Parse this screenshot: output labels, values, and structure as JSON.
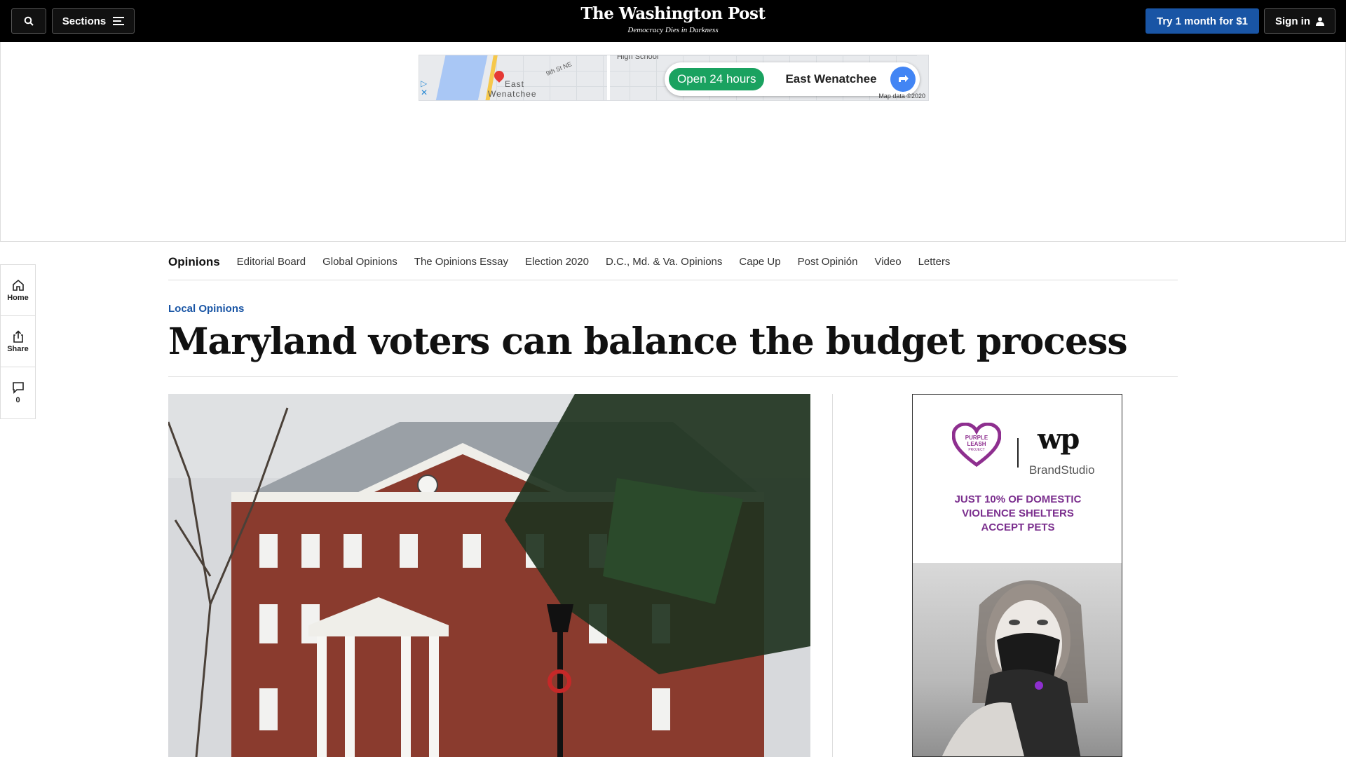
{
  "topbar": {
    "sections_label": "Sections",
    "masthead_title": "The Washington Post",
    "masthead_tagline": "Democracy Dies in Darkness",
    "subscribe_label": "Try 1 month for $1",
    "signin_label": "Sign in"
  },
  "map_ad": {
    "map_label_1": "East",
    "map_label_2": "Wenatchee",
    "street_label": "9th St NE",
    "school_label": "High School",
    "open_label": "Open 24 hours",
    "place_label": "East Wenatchee",
    "map_data_label": "Map data ©2020"
  },
  "rail": {
    "home_label": "Home",
    "share_label": "Share",
    "comments_count": "0"
  },
  "subnav": {
    "title": "Opinions",
    "items": [
      "Editorial Board",
      "Global Opinions",
      "The Opinions Essay",
      "Election 2020",
      "D.C., Md. & Va. Opinions",
      "Cape Up",
      "Post Opinión",
      "Video",
      "Letters"
    ]
  },
  "article": {
    "kicker": "Local Opinions",
    "headline": "Maryland voters can balance the budget process"
  },
  "side_ad": {
    "purple_leash_line1": "PURPLE",
    "purple_leash_line2": "LEASH",
    "purple_leash_line3": "PROJECT",
    "wp_logo": "wp",
    "brandstudio": "BrandStudio",
    "headline_line1": "JUST 10% OF DOMESTIC",
    "headline_line2": "VIOLENCE SHELTERS",
    "headline_line3": "ACCEPT PETS"
  },
  "colors": {
    "topbar_bg": "#000000",
    "subscribe_bg": "#1955a5",
    "kicker": "#1955a5",
    "ad_purple": "#7b2f8e"
  }
}
